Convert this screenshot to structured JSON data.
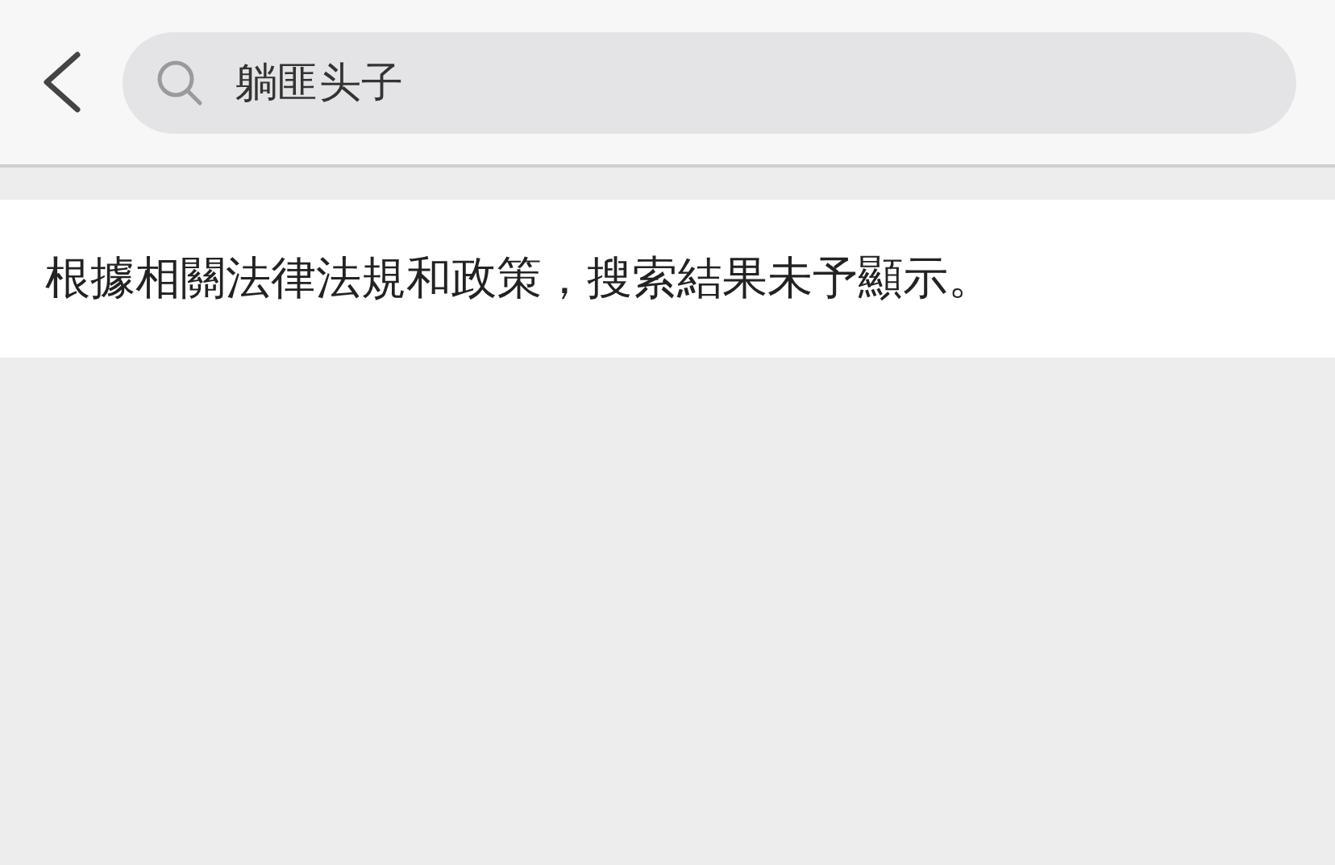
{
  "search": {
    "value": "躺匪头子"
  },
  "notice": "根據相關法律法規和政策，搜索結果未予顯示。"
}
